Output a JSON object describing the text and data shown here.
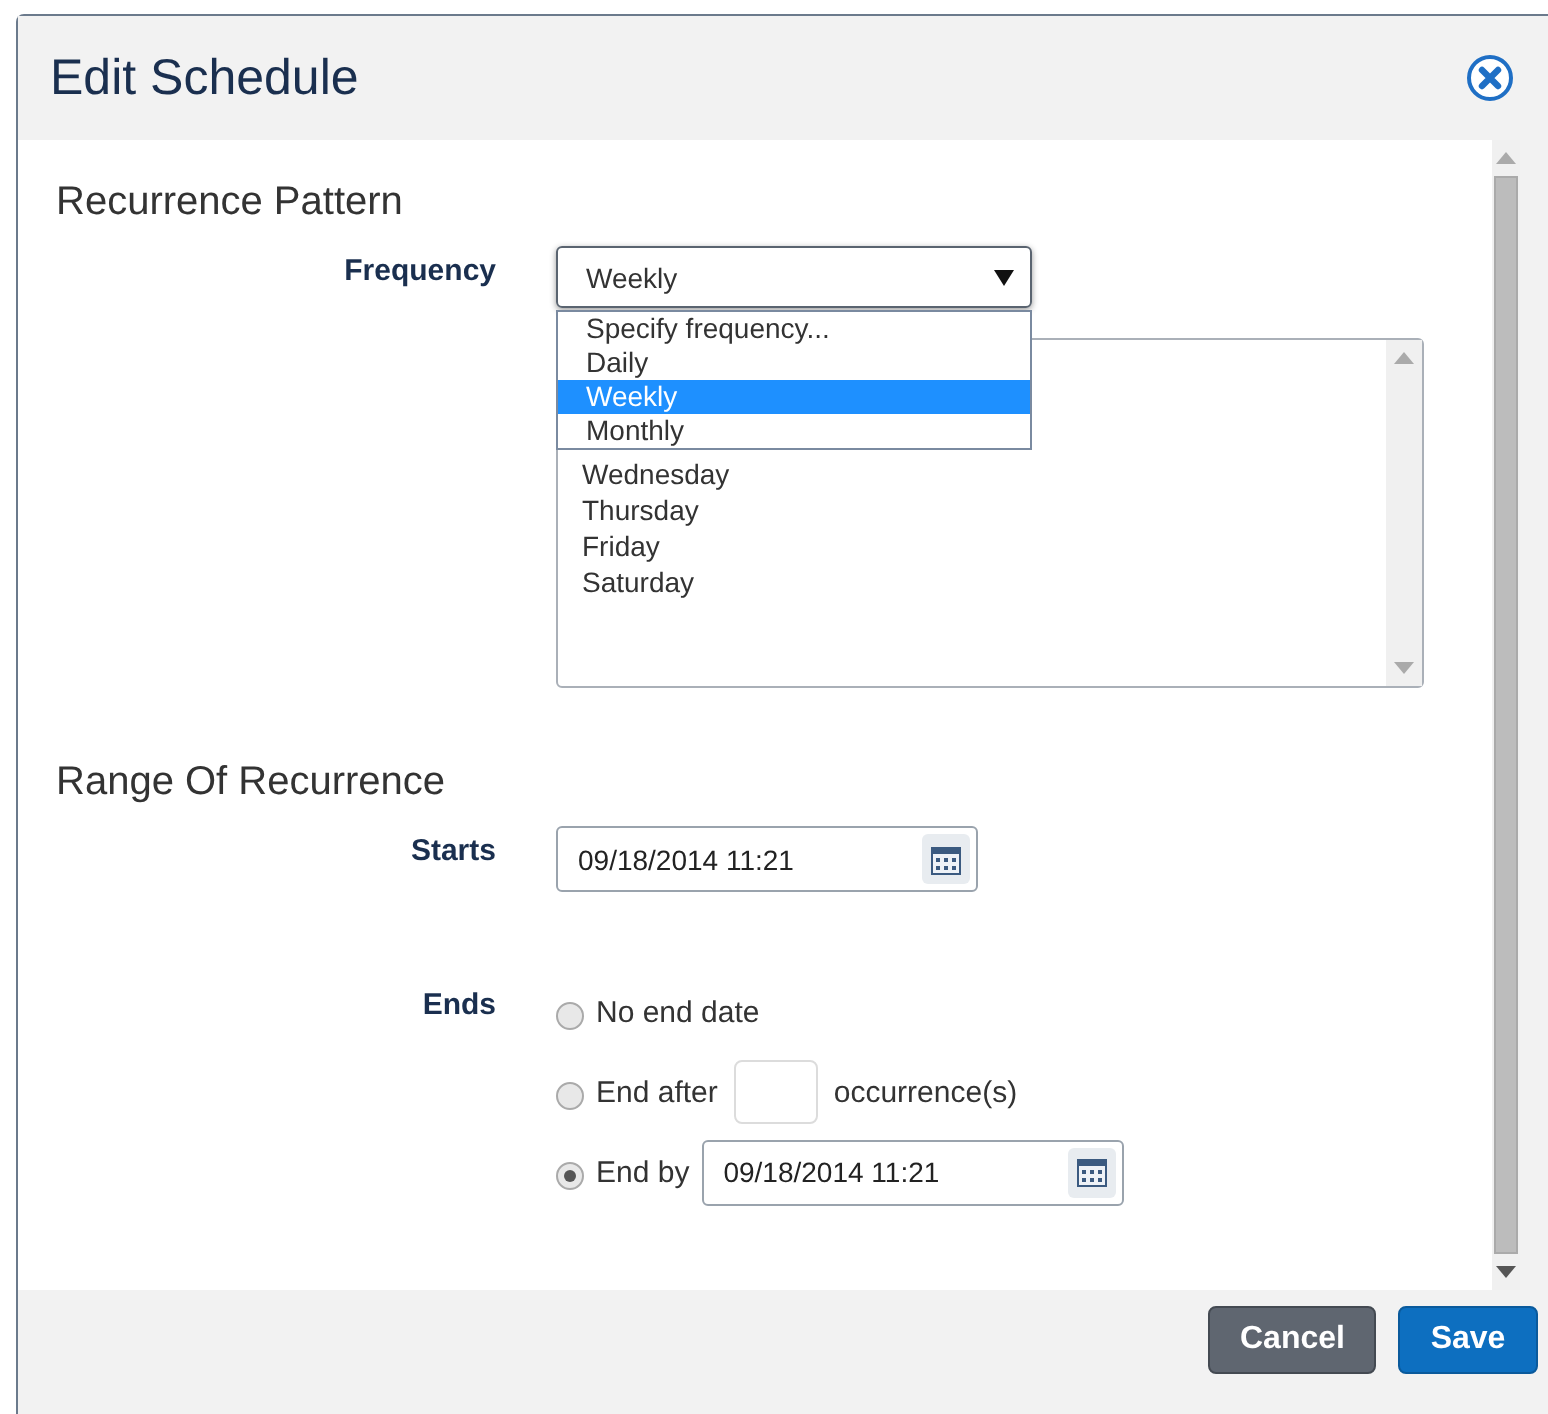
{
  "dialog": {
    "title": "Edit Schedule"
  },
  "recurrence_pattern": {
    "heading": "Recurrence Pattern",
    "frequency_label": "Frequency",
    "frequency_value": "Weekly",
    "expanded": true,
    "options": [
      {
        "label": "Specify frequency...",
        "selected": false
      },
      {
        "label": "Daily",
        "selected": false
      },
      {
        "label": "Weekly",
        "selected": true
      },
      {
        "label": "Monthly",
        "selected": false
      }
    ],
    "days": [
      "Wednesday",
      "Thursday",
      "Friday",
      "Saturday"
    ]
  },
  "range_of_recurrence": {
    "heading": "Range Of Recurrence",
    "starts_label": "Starts",
    "starts_value": "09/18/2014 11:21",
    "ends_label": "Ends",
    "end_options": [
      {
        "kind": "plain",
        "label": "No end date",
        "selected": false
      },
      {
        "kind": "count",
        "label": "End after",
        "suffix": "occurrence(s)",
        "selected": false
      },
      {
        "kind": "date",
        "label": "End by",
        "value": "09/18/2014 11:21",
        "selected": true
      }
    ]
  },
  "buttons": [
    {
      "label": "Cancel",
      "kind": "secondary"
    },
    {
      "label": "Save",
      "kind": "primary"
    }
  ]
}
